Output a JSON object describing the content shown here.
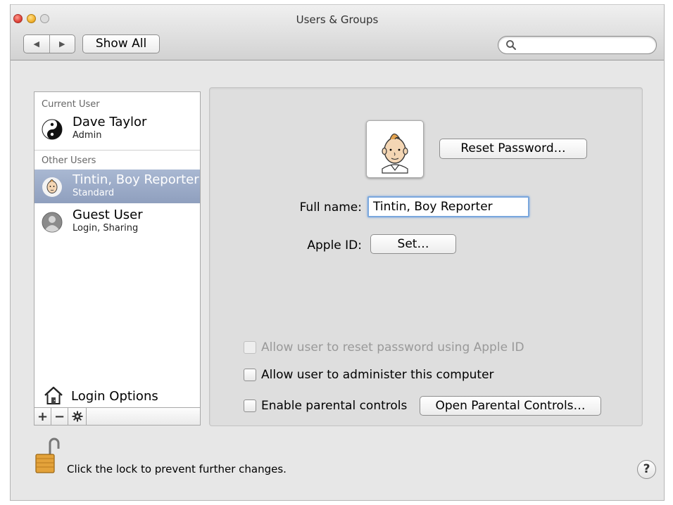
{
  "window": {
    "title": "Users & Groups"
  },
  "toolbar": {
    "show_all_label": "Show All",
    "search_placeholder": ""
  },
  "sidebar": {
    "current_user_header": "Current User",
    "other_users_header": "Other Users",
    "users": [
      {
        "name": "Dave Taylor",
        "role": "Admin"
      },
      {
        "name": "Tintin, Boy Reporter",
        "role": "Standard"
      },
      {
        "name": "Guest User",
        "role": "Login, Sharing"
      }
    ],
    "login_options_label": "Login Options",
    "add_label": "+",
    "remove_label": "−"
  },
  "detail": {
    "reset_password_label": "Reset Password…",
    "full_name_label": "Full name:",
    "full_name_value": "Tintin, Boy Reporter",
    "apple_id_label": "Apple ID:",
    "set_label": "Set…",
    "checkboxes": [
      {
        "label": "Allow user to reset password using Apple ID",
        "checked": false,
        "enabled": false
      },
      {
        "label": "Allow user to administer this computer",
        "checked": false,
        "enabled": true
      },
      {
        "label": "Enable parental controls",
        "checked": false,
        "enabled": true
      }
    ],
    "open_parental_label": "Open Parental Controls…"
  },
  "footer": {
    "lock_text": "Click the lock to prevent further changes.",
    "help_label": "?"
  },
  "colors": {
    "selection": "#97a7c4",
    "focus_ring": "#7aa7dd"
  }
}
